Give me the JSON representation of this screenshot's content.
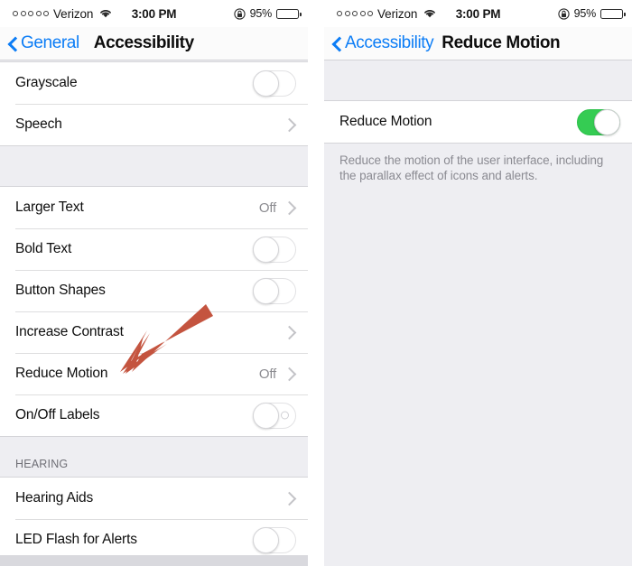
{
  "colors": {
    "accent_blue": "#0c7df6",
    "switch_on_green": "#35cc53",
    "arrow_red": "#c4543f",
    "group_bg": "#ffffff",
    "page_bg": "#eeeef2",
    "secondary_text": "#8b8b90"
  },
  "status_bar": {
    "signal_dots": 5,
    "signal_icon": "signal-dots-icon",
    "carrier": "Verizon",
    "wifi_icon": "wifi-icon",
    "time": "3:00 PM",
    "rotation_lock_icon": "rotation-lock-icon",
    "battery_percent": "95%",
    "battery_icon": "battery-full-icon"
  },
  "left_panel": {
    "nav": {
      "back_icon": "chevron-left-icon",
      "back_label": "General",
      "title": "Accessibility"
    },
    "groups": [
      {
        "header": "",
        "rows": [
          {
            "label": "Grayscale",
            "type": "switch",
            "switch_state": "off"
          },
          {
            "label": "Speech",
            "type": "disclosure",
            "value": "",
            "chevron_icon": "chevron-right-icon"
          }
        ]
      },
      {
        "header": "",
        "rows": [
          {
            "label": "Larger Text",
            "type": "disclosure",
            "value": "Off",
            "chevron_icon": "chevron-right-icon"
          },
          {
            "label": "Bold Text",
            "type": "switch",
            "switch_state": "off"
          },
          {
            "label": "Button Shapes",
            "type": "switch",
            "switch_state": "off"
          },
          {
            "label": "Increase Contrast",
            "type": "disclosure",
            "value": "",
            "chevron_icon": "chevron-right-icon"
          },
          {
            "label": "Reduce Motion",
            "type": "disclosure",
            "value": "Off",
            "chevron_icon": "chevron-right-icon"
          },
          {
            "label": "On/Off Labels",
            "type": "switch-labels",
            "switch_state": "off"
          }
        ]
      },
      {
        "header": "HEARING",
        "rows": [
          {
            "label": "Hearing Aids",
            "type": "disclosure",
            "value": "",
            "chevron_icon": "chevron-right-icon"
          },
          {
            "label": "LED Flash for Alerts",
            "type": "switch",
            "switch_state": "off"
          }
        ]
      }
    ]
  },
  "right_panel": {
    "nav": {
      "back_icon": "chevron-left-icon",
      "back_label": "Accessibility",
      "title": "Reduce Motion"
    },
    "rows": [
      {
        "label": "Reduce Motion",
        "type": "switch",
        "switch_state": "on"
      }
    ],
    "footnote": "Reduce the motion of the user interface, including the parallax effect of icons and alerts."
  },
  "annotation": {
    "arrow_name": "pointer-arrow",
    "points_at": "Reduce Motion",
    "color": "#c4543f"
  }
}
